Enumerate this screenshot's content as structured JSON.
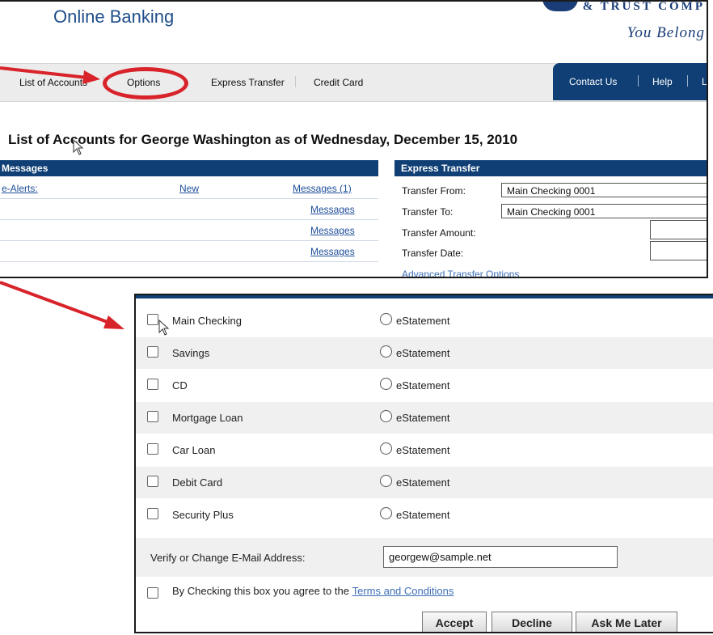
{
  "header": {
    "app_title": "Online Banking",
    "brand_text": "& TRUST COMP",
    "tagline": "You Belong"
  },
  "nav": {
    "items": [
      "List of Accounts",
      "Options",
      "Express Transfer",
      "Credit Card"
    ],
    "right_items": [
      "Contact Us",
      "Help",
      "L"
    ]
  },
  "page_heading": "List of Accounts for George Washington as of Wednesday, December 15, 2010",
  "messages": {
    "title": "Messages",
    "rows": [
      {
        "label": "e-Alerts:",
        "status": "New",
        "link": "Messages (1)"
      },
      {
        "label": "",
        "status": "",
        "link": "Messages"
      },
      {
        "label": "",
        "status": "",
        "link": "Messages"
      },
      {
        "label": "",
        "status": "",
        "link": "Messages"
      }
    ]
  },
  "express_transfer": {
    "title": "Express Transfer",
    "from_label": "Transfer From:",
    "from_value": "Main Checking 0001",
    "to_label": "Transfer To:",
    "to_value": "Main Checking 0001",
    "amount_label": "Transfer Amount:",
    "date_label": "Transfer Date:",
    "advanced_link": "Advanced Transfer Options"
  },
  "estatement_form": {
    "accounts": [
      {
        "name": "Main Checking",
        "option": "eStatement"
      },
      {
        "name": "Savings",
        "option": "eStatement"
      },
      {
        "name": "CD",
        "option": "eStatement"
      },
      {
        "name": "Mortgage Loan",
        "option": "eStatement"
      },
      {
        "name": "Car Loan",
        "option": "eStatement"
      },
      {
        "name": "Debit Card",
        "option": "eStatement"
      },
      {
        "name": "Security Plus",
        "option": "eStatement"
      }
    ],
    "email_label": "Verify or Change E-Mail Address:",
    "email_value": "georgew@sample.net",
    "terms_text": "By Checking this box you agree to the",
    "terms_link": "Terms and Conditions",
    "buttons": {
      "accept": "Accept",
      "decline": "Decline",
      "later": "Ask Me Later"
    }
  },
  "colors": {
    "navy": "#0f3f75",
    "annotation_red": "#d8232a",
    "link_blue": "#1f4f9a"
  }
}
